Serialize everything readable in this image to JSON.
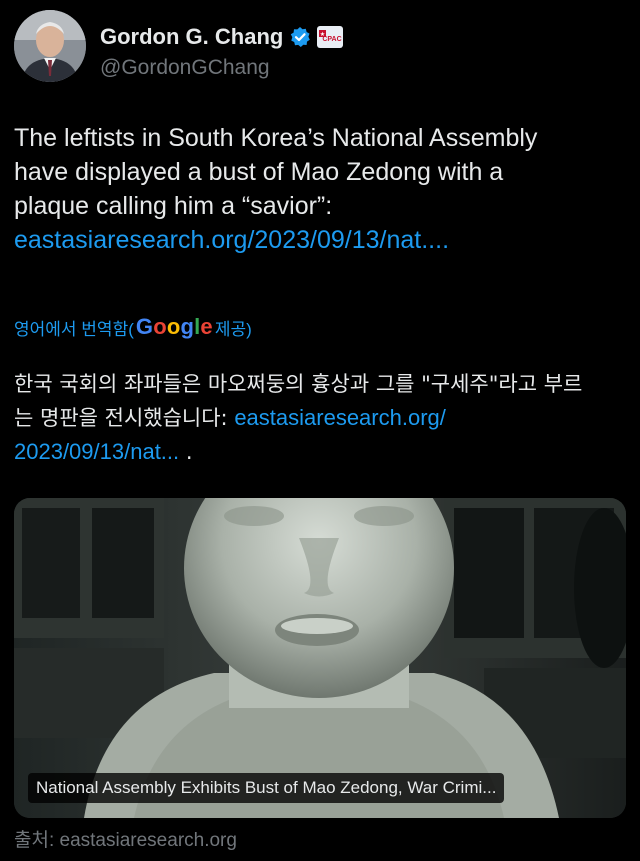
{
  "author": {
    "name": "Gordon G. Chang",
    "handle": "@GordonGChang",
    "badge_text": "CPAC"
  },
  "tweet": {
    "text_lines": [
      "The leftists in South Korea’s National Assembly",
      "have displayed a bust of Mao Zedong with a",
      "plaque calling him a “savior”:"
    ],
    "link": "eastasiaresearch.org/2023/09/13/nat...."
  },
  "translation": {
    "prefix": "영어에서 번역함(",
    "google": [
      "G",
      "o",
      "o",
      "g",
      "l",
      "e"
    ],
    "suffix": " 제공)",
    "text_line1": "한국 국회의 좌파들은 마오쩌둥의 흉상과 그를 \"구세주\"라고 부르",
    "text_line2_prefix": "는 명판을 전시했습니다: ",
    "link_part1": "eastasiaresearch.org/",
    "link_part2": "2023/09/13/nat...",
    "trail": " ."
  },
  "card": {
    "caption": "National Assembly Exhibits Bust of Mao Zedong, War Crimi...",
    "source": "출처: eastasiaresearch.org"
  },
  "colors": {
    "background": "#000000",
    "text": "#e7e9ea",
    "muted": "#71767b",
    "link": "#1d9bf0"
  }
}
